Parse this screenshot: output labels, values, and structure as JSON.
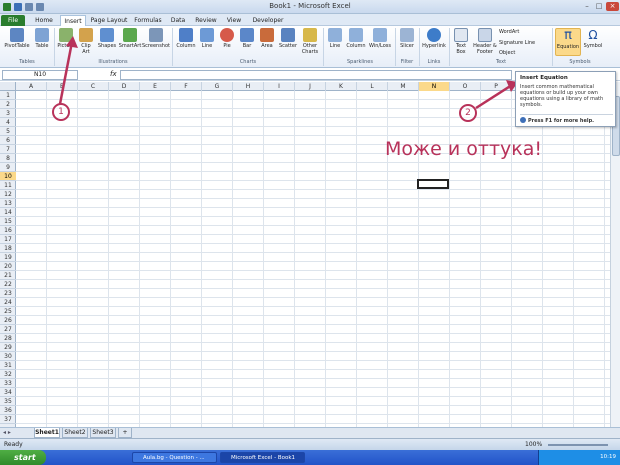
{
  "window": {
    "title": "Book1 - Microsoft Excel"
  },
  "tabs": [
    {
      "id": "file",
      "label": "File"
    },
    {
      "id": "home",
      "label": "Home"
    },
    {
      "id": "insert",
      "label": "Insert"
    },
    {
      "id": "page_layout",
      "label": "Page Layout"
    },
    {
      "id": "formulas",
      "label": "Formulas"
    },
    {
      "id": "data",
      "label": "Data"
    },
    {
      "id": "review",
      "label": "Review"
    },
    {
      "id": "view",
      "label": "View"
    },
    {
      "id": "developer",
      "label": "Developer"
    }
  ],
  "ribbon": {
    "buttons": {
      "pivottable": "PivotTable",
      "table": "Table",
      "picture": "Picture",
      "clip_art": "Clip Art",
      "shapes": "Shapes",
      "smartart": "SmartArt",
      "screenshot": "Screenshot",
      "column": "Column",
      "line": "Line",
      "pie": "Pie",
      "bar": "Bar",
      "area": "Area",
      "scatter": "Scatter",
      "other_charts": "Other Charts",
      "spark_line": "Line",
      "spark_column": "Column",
      "win_loss": "Win/Loss",
      "slicer": "Slicer",
      "hyperlink": "Hyperlink",
      "text_box": "Text Box",
      "header_footer": "Header & Footer",
      "wordart": "WordArt",
      "signature_line": "Signature Line",
      "object": "Object",
      "equation": "Equation",
      "symbol": "Symbol"
    },
    "groups": {
      "tables": "Tables",
      "illustrations": "Illustrations",
      "charts": "Charts",
      "sparklines": "Sparklines",
      "filter": "Filter",
      "links": "Links",
      "text": "Text",
      "symbols": "Symbols"
    }
  },
  "formula_bar": {
    "name_box": "N10",
    "fx": "fx",
    "formula": ""
  },
  "grid": {
    "columns": [
      "A",
      "B",
      "C",
      "D",
      "E",
      "F",
      "G",
      "H",
      "I",
      "J",
      "K",
      "L",
      "M",
      "N",
      "O",
      "P"
    ],
    "rows": [
      "1",
      "2",
      "3",
      "4",
      "5",
      "6",
      "7",
      "8",
      "9",
      "10",
      "11",
      "12",
      "13",
      "14",
      "15",
      "16",
      "17",
      "18",
      "19",
      "20",
      "21",
      "22",
      "23",
      "24",
      "25",
      "26",
      "27",
      "28",
      "29",
      "30",
      "31",
      "32",
      "33",
      "34",
      "35",
      "36",
      "37"
    ],
    "selected_column": "N",
    "selected_row": "10"
  },
  "overlay_text": "Може и оттука!",
  "annotations": [
    "1",
    "2"
  ],
  "tooltip": {
    "title": "Insert Equation",
    "description": "Insert common mathematical equations or build up your own equations using a library of math symbols.",
    "help": "Press F1 for more help."
  },
  "sheets": [
    "Sheet1",
    "Sheet2",
    "Sheet3"
  ],
  "status": {
    "ready": "Ready",
    "zoom": "100%"
  },
  "taskbar": {
    "start": "start",
    "items": [
      "Aula.bg - Question - ...",
      "Microsoft Excel - Book1"
    ],
    "clock": "10:19"
  },
  "colors": {
    "accent": "#b8325a",
    "file_tab": "#2a7d2e",
    "selection": "#fbd98a"
  }
}
